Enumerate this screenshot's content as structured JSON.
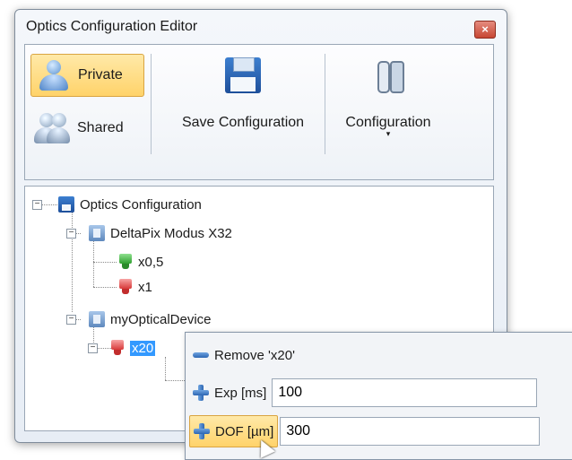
{
  "window": {
    "title": "Optics Configuration Editor",
    "close_glyph": "×"
  },
  "ribbon": {
    "private_label": "Private",
    "shared_label": "Shared",
    "save_label": "Save Configuration",
    "config_label": "Configuration",
    "config_caret": "▾"
  },
  "tree": {
    "root": "Optics Configuration",
    "devices": [
      {
        "label": "DeltaPix Modus X32",
        "objectives": [
          "x0,5",
          "x1"
        ]
      },
      {
        "label": "myOpticalDevice",
        "objectives": [
          "x20"
        ]
      }
    ],
    "expander_glyph": "−"
  },
  "popup": {
    "remove_label": "Remove 'x20'",
    "exp_label": "Exp [ms]",
    "exp_value": "100",
    "dof_label": "DOF [µm]",
    "dof_value": "300"
  },
  "colors": {
    "accent_highlight": "#ffd36a",
    "selection": "#3399ff",
    "lens_green": "#2f9f2f",
    "lens_red": "#d83a3a"
  }
}
